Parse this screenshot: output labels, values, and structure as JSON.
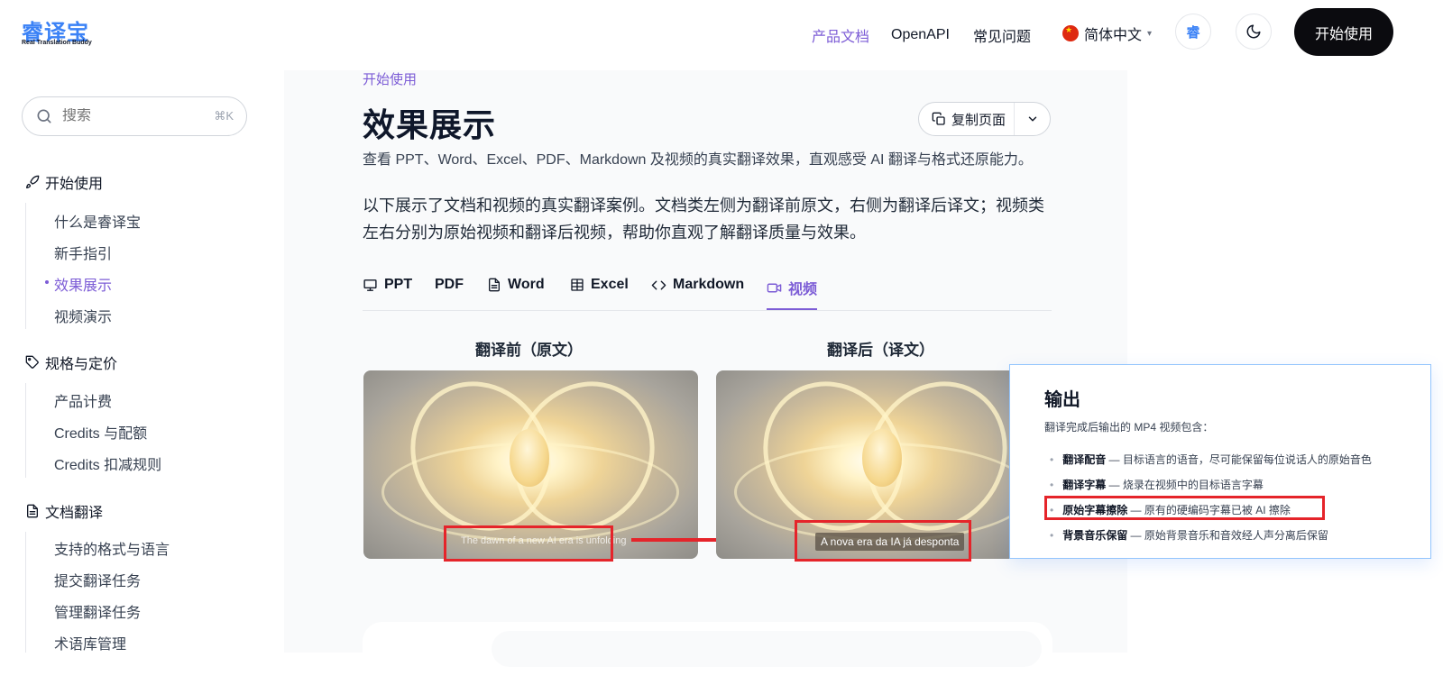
{
  "header": {
    "logo_main": "睿译宝",
    "logo_sub": "Real Translation Buddy",
    "nav": [
      "产品文档",
      "OpenAPI",
      "常见问题"
    ],
    "language": "简体中文",
    "avatar_char": "睿",
    "start_label": "开始使用"
  },
  "search": {
    "placeholder": "搜索",
    "shortcut": "⌘K"
  },
  "sidebar": {
    "sections": [
      {
        "label": "开始使用",
        "items": [
          "什么是睿译宝",
          "新手指引",
          "效果展示",
          "视频演示"
        ]
      },
      {
        "label": "规格与定价",
        "items": [
          "产品计费",
          "Credits 与配额",
          "Credits 扣减规则"
        ]
      },
      {
        "label": "文档翻译",
        "items": [
          "支持的格式与语言",
          "提交翻译任务",
          "管理翻译任务",
          "术语库管理"
        ]
      }
    ],
    "active_item": "效果展示"
  },
  "page": {
    "breadcrumb": "开始使用",
    "title": "效果展示",
    "copy_label": "复制页面",
    "description": "查看 PPT、Word、Excel、PDF、Markdown 及视频的真实翻译效果，直观感受 AI 翻译与格式还原能力。",
    "intro": "以下展示了文档和视频的真实翻译案例。文档类左侧为翻译前原文，右侧为翻译后译文；视频类左右分别为原始视频和翻译后视频，帮助你直观了解翻译质量与效果。",
    "tabs": [
      "PPT",
      "PDF",
      "Word",
      "Excel",
      "Markdown",
      "视频"
    ],
    "active_tab": "视频",
    "col_before": "翻译前（原文）",
    "col_after": "翻译后（译文）",
    "subtitle_before": "The dawn of a new AI era is unfolding",
    "subtitle_after": "A nova era da IA já desponta"
  },
  "output": {
    "title": "输出",
    "desc": "翻译完成后输出的 MP4 视频包含：",
    "items": [
      {
        "bold": "翻译配音",
        "text": " — 目标语言的语音，尽可能保留每位说话人的原始音色"
      },
      {
        "bold": "翻译字幕",
        "text": " — 烧录在视频中的目标语言字幕"
      },
      {
        "bold": "原始字幕擦除",
        "text": " — 原有的硬编码字幕已被 AI 擦除"
      },
      {
        "bold": "背景音乐保留",
        "text": " — 原始背景音乐和音效经人声分离后保留"
      }
    ]
  },
  "colors": {
    "accent": "#7c5cd6",
    "highlight": "#e5242a",
    "popover_border": "#93c5fd"
  }
}
